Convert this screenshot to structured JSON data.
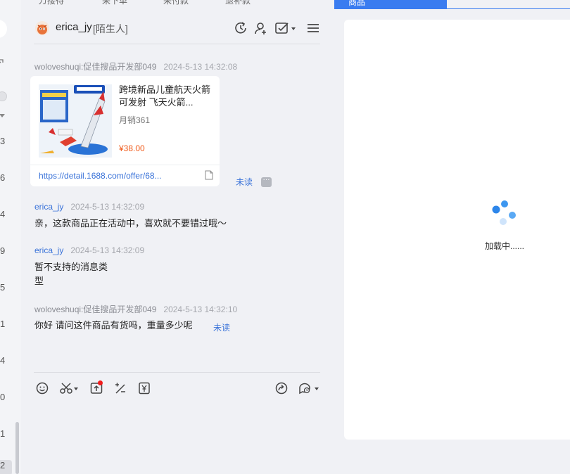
{
  "top_tabs": [
    "万接待",
    "采下单",
    "采付款",
    "退补款"
  ],
  "left_list": {
    "numbers": [
      "3",
      "6",
      "4",
      "9",
      "5",
      "1",
      "4",
      "0",
      "1"
    ],
    "selected": "2"
  },
  "header": {
    "name": "erica_jy",
    "tag": "[陌生人]",
    "icons": [
      "refresh-clock-icon",
      "user-add-icon",
      "task-check-icon",
      "menu-icon"
    ]
  },
  "messages": [
    {
      "sender": "woloveshuqi:促佳搜品开发部049",
      "time": "2024-5-13 14:32:08",
      "type": "product",
      "product": {
        "title": "跨境新品儿童航天火箭可发射 飞天火箭...",
        "sales": "月销361",
        "price": "¥38.00",
        "link": "https://detail.1688.com/offer/68..."
      },
      "status": "未读"
    },
    {
      "sender": "erica_jy",
      "time": "2024-5-13 14:32:09",
      "type": "text",
      "text": "亲，这款商品正在活动中，喜欢就不要错过哦～"
    },
    {
      "sender": "erica_jy",
      "time": "2024-5-13 14:32:09",
      "type": "text",
      "text_lines": [
        "暂不支持的消息类",
        "型"
      ]
    },
    {
      "sender": "woloveshuqi:促佳搜品开发部049",
      "time": "2024-5-13 14:32:10",
      "type": "text",
      "text": "你好 请问这件商品有货吗，重量多少呢",
      "status": "未读"
    }
  ],
  "toolbar": {
    "icons": [
      "emoji-icon",
      "scissors-icon",
      "upload-icon",
      "discount-icon",
      "yen-icon",
      "share-icon",
      "quick-reply-icon"
    ]
  },
  "right_pane": {
    "tab_label": "商品",
    "loading_text": "加载中......"
  },
  "colors": {
    "accent": "#3a7cf0",
    "link": "#3a73d9",
    "price": "#f05a1a",
    "badge": "#f01c1c"
  }
}
